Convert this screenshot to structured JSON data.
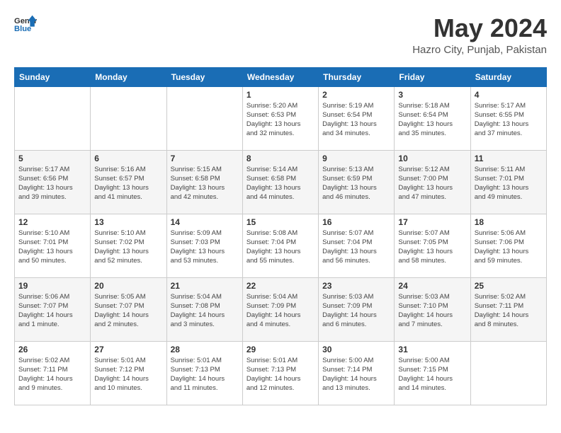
{
  "logo": {
    "line1": "General",
    "line2": "Blue"
  },
  "title": "May 2024",
  "location": "Hazro City, Punjab, Pakistan",
  "weekdays": [
    "Sunday",
    "Monday",
    "Tuesday",
    "Wednesday",
    "Thursday",
    "Friday",
    "Saturday"
  ],
  "weeks": [
    [
      {
        "day": "",
        "info": ""
      },
      {
        "day": "",
        "info": ""
      },
      {
        "day": "",
        "info": ""
      },
      {
        "day": "1",
        "info": "Sunrise: 5:20 AM\nSunset: 6:53 PM\nDaylight: 13 hours\nand 32 minutes."
      },
      {
        "day": "2",
        "info": "Sunrise: 5:19 AM\nSunset: 6:54 PM\nDaylight: 13 hours\nand 34 minutes."
      },
      {
        "day": "3",
        "info": "Sunrise: 5:18 AM\nSunset: 6:54 PM\nDaylight: 13 hours\nand 35 minutes."
      },
      {
        "day": "4",
        "info": "Sunrise: 5:17 AM\nSunset: 6:55 PM\nDaylight: 13 hours\nand 37 minutes."
      }
    ],
    [
      {
        "day": "5",
        "info": "Sunrise: 5:17 AM\nSunset: 6:56 PM\nDaylight: 13 hours\nand 39 minutes."
      },
      {
        "day": "6",
        "info": "Sunrise: 5:16 AM\nSunset: 6:57 PM\nDaylight: 13 hours\nand 41 minutes."
      },
      {
        "day": "7",
        "info": "Sunrise: 5:15 AM\nSunset: 6:58 PM\nDaylight: 13 hours\nand 42 minutes."
      },
      {
        "day": "8",
        "info": "Sunrise: 5:14 AM\nSunset: 6:58 PM\nDaylight: 13 hours\nand 44 minutes."
      },
      {
        "day": "9",
        "info": "Sunrise: 5:13 AM\nSunset: 6:59 PM\nDaylight: 13 hours\nand 46 minutes."
      },
      {
        "day": "10",
        "info": "Sunrise: 5:12 AM\nSunset: 7:00 PM\nDaylight: 13 hours\nand 47 minutes."
      },
      {
        "day": "11",
        "info": "Sunrise: 5:11 AM\nSunset: 7:01 PM\nDaylight: 13 hours\nand 49 minutes."
      }
    ],
    [
      {
        "day": "12",
        "info": "Sunrise: 5:10 AM\nSunset: 7:01 PM\nDaylight: 13 hours\nand 50 minutes."
      },
      {
        "day": "13",
        "info": "Sunrise: 5:10 AM\nSunset: 7:02 PM\nDaylight: 13 hours\nand 52 minutes."
      },
      {
        "day": "14",
        "info": "Sunrise: 5:09 AM\nSunset: 7:03 PM\nDaylight: 13 hours\nand 53 minutes."
      },
      {
        "day": "15",
        "info": "Sunrise: 5:08 AM\nSunset: 7:04 PM\nDaylight: 13 hours\nand 55 minutes."
      },
      {
        "day": "16",
        "info": "Sunrise: 5:07 AM\nSunset: 7:04 PM\nDaylight: 13 hours\nand 56 minutes."
      },
      {
        "day": "17",
        "info": "Sunrise: 5:07 AM\nSunset: 7:05 PM\nDaylight: 13 hours\nand 58 minutes."
      },
      {
        "day": "18",
        "info": "Sunrise: 5:06 AM\nSunset: 7:06 PM\nDaylight: 13 hours\nand 59 minutes."
      }
    ],
    [
      {
        "day": "19",
        "info": "Sunrise: 5:06 AM\nSunset: 7:07 PM\nDaylight: 14 hours\nand 1 minute."
      },
      {
        "day": "20",
        "info": "Sunrise: 5:05 AM\nSunset: 7:07 PM\nDaylight: 14 hours\nand 2 minutes."
      },
      {
        "day": "21",
        "info": "Sunrise: 5:04 AM\nSunset: 7:08 PM\nDaylight: 14 hours\nand 3 minutes."
      },
      {
        "day": "22",
        "info": "Sunrise: 5:04 AM\nSunset: 7:09 PM\nDaylight: 14 hours\nand 4 minutes."
      },
      {
        "day": "23",
        "info": "Sunrise: 5:03 AM\nSunset: 7:09 PM\nDaylight: 14 hours\nand 6 minutes."
      },
      {
        "day": "24",
        "info": "Sunrise: 5:03 AM\nSunset: 7:10 PM\nDaylight: 14 hours\nand 7 minutes."
      },
      {
        "day": "25",
        "info": "Sunrise: 5:02 AM\nSunset: 7:11 PM\nDaylight: 14 hours\nand 8 minutes."
      }
    ],
    [
      {
        "day": "26",
        "info": "Sunrise: 5:02 AM\nSunset: 7:11 PM\nDaylight: 14 hours\nand 9 minutes."
      },
      {
        "day": "27",
        "info": "Sunrise: 5:01 AM\nSunset: 7:12 PM\nDaylight: 14 hours\nand 10 minutes."
      },
      {
        "day": "28",
        "info": "Sunrise: 5:01 AM\nSunset: 7:13 PM\nDaylight: 14 hours\nand 11 minutes."
      },
      {
        "day": "29",
        "info": "Sunrise: 5:01 AM\nSunset: 7:13 PM\nDaylight: 14 hours\nand 12 minutes."
      },
      {
        "day": "30",
        "info": "Sunrise: 5:00 AM\nSunset: 7:14 PM\nDaylight: 14 hours\nand 13 minutes."
      },
      {
        "day": "31",
        "info": "Sunrise: 5:00 AM\nSunset: 7:15 PM\nDaylight: 14 hours\nand 14 minutes."
      },
      {
        "day": "",
        "info": ""
      }
    ]
  ]
}
